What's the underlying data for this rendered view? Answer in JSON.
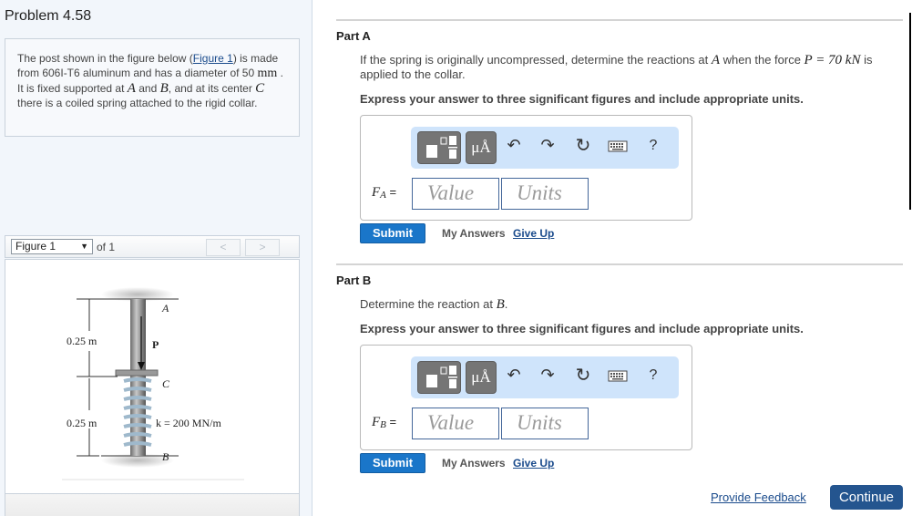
{
  "problem": {
    "title": "Problem 4.58",
    "intro": {
      "t1": "The post shown in the figure below (",
      "figure_link": "Figure 1",
      "t2": ") is made from 606I-T6 aluminum and has a diameter of 50 ",
      "unit_mm": "mm",
      "t3": " . It is fixed supported at ",
      "A": "A",
      "t4": " and ",
      "B": "B",
      "t5": ", and at its center ",
      "C": "C",
      "t6": " there is a coiled spring attached to the rigid collar."
    }
  },
  "figure_nav": {
    "selected": "Figure 1",
    "of_label": "of 1",
    "prev": "<",
    "next": ">"
  },
  "figure": {
    "label_A": "A",
    "label_B": "B",
    "label_C": "C",
    "label_P": "P",
    "dim_top": "0.25 m",
    "dim_bottom": "0.25 m",
    "spring_label": "k = 200 MN/m"
  },
  "parts": [
    {
      "title": "Part A",
      "q1": "If the spring is originally uncompressed, determine the reactions at ",
      "q_var": "A",
      "q2": " when the force ",
      "q_math": "P = 70 kN",
      "q3": " is applied to the collar.",
      "express": "Express your answer to three significant figures and include appropriate units.",
      "label_var": "F",
      "label_sub": "A",
      "label_eq": " =",
      "value_placeholder": "Value",
      "units_placeholder": "Units",
      "submit": "Submit",
      "my_answers": "My Answers",
      "give_up": "Give Up"
    },
    {
      "title": "Part B",
      "q1": "Determine the reaction at ",
      "q_var": "B",
      "q3": ".",
      "express": "Express your answer to three significant figures and include appropriate units.",
      "label_var": "F",
      "label_sub": "B",
      "label_eq": " =",
      "value_placeholder": "Value",
      "units_placeholder": "Units",
      "submit": "Submit",
      "my_answers": "My Answers",
      "give_up": "Give Up"
    }
  ],
  "toolbar": {
    "templates_icon": "templates-icon",
    "units_label": "μÅ",
    "undo": "undo-icon",
    "redo": "redo-icon",
    "reset": "reset-icon",
    "keyboard": "keyboard-icon",
    "help": "?"
  },
  "footer": {
    "feedback": "Provide Feedback",
    "continue": "Continue"
  },
  "colors": {
    "submit": "#1a76c9",
    "continue": "#24558f",
    "toolbar_bg": "#cfe4fb",
    "link": "#1a4b8c"
  }
}
